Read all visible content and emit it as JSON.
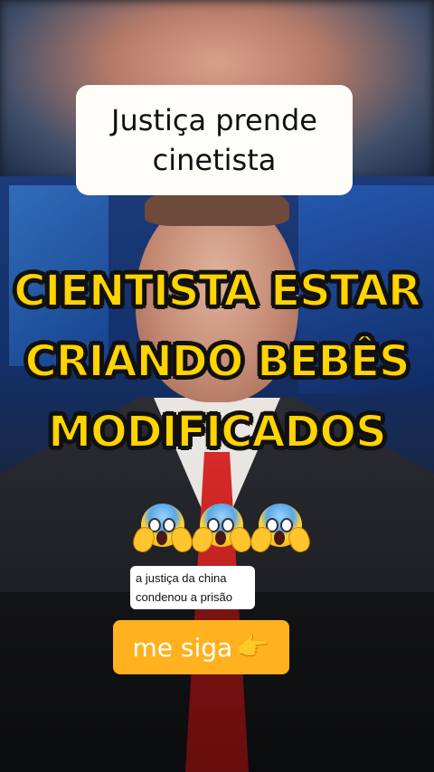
{
  "overlay": {
    "title": "Justiça prende\ncinetista",
    "headline_lines": [
      "CIENTISTA ESTAR",
      "CRIANDO  BEBÊS",
      "MODIFICADOS"
    ],
    "emoji_icons": [
      "face-screaming-in-fear-icon",
      "face-screaming-in-fear-icon",
      "face-screaming-in-fear-icon"
    ],
    "caption_lines": [
      "a justiça da china",
      "condenou a prisão"
    ],
    "follow_button": {
      "label": "me siga",
      "icon": "pointing-right-hand-icon"
    }
  },
  "colors": {
    "headline": "#ffd400",
    "headline_outline": "#111111",
    "button_bg": "#ffb21e",
    "title_bg": "#fffdf8"
  }
}
